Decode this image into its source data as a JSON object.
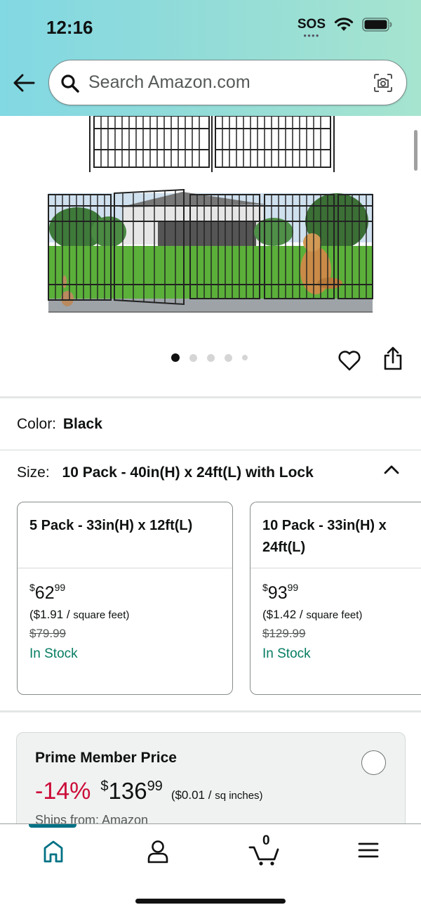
{
  "status_bar": {
    "time": "12:16",
    "sos": "SOS"
  },
  "search": {
    "placeholder": "Search Amazon.com"
  },
  "gallery": {
    "image_count": 5,
    "active_index": 0
  },
  "color": {
    "label": "Color:",
    "value": "Black"
  },
  "size": {
    "label": "Size:",
    "value": "10 Pack - 40in(H) x 24ft(L) with Lock"
  },
  "size_options": [
    {
      "title": "5 Pack - 33in(H) x 12ft(L)",
      "price_currency": "$",
      "price_whole": "62",
      "price_fraction": "99",
      "unit_price_value": "($1.91 / ",
      "unit_price_unit": "square feet)",
      "list_price": "$79.99",
      "stock": "In Stock"
    },
    {
      "title": "10 Pack - 33in(H) x 24ft(L)",
      "price_currency": "$",
      "price_whole": "93",
      "price_fraction": "99",
      "unit_price_value": "($1.42 / ",
      "unit_price_unit": "square feet)",
      "list_price": "$129.99",
      "stock": "In Stock"
    }
  ],
  "prime": {
    "title": "Prime Member Price",
    "discount": "-14%",
    "price_currency": "$",
    "price_whole": "136",
    "price_fraction": "99",
    "unit_price_value": "($0.01 / ",
    "unit_price_unit": "sq inches)",
    "ships_from": "Ships from: Amazon"
  },
  "bottom_nav": {
    "cart_count": "0",
    "items": [
      "home-icon",
      "account-icon",
      "cart-icon",
      "menu-icon"
    ]
  },
  "colors": {
    "teal": "#007185",
    "in_stock": "#067d62",
    "discount": "#cc0c39"
  }
}
